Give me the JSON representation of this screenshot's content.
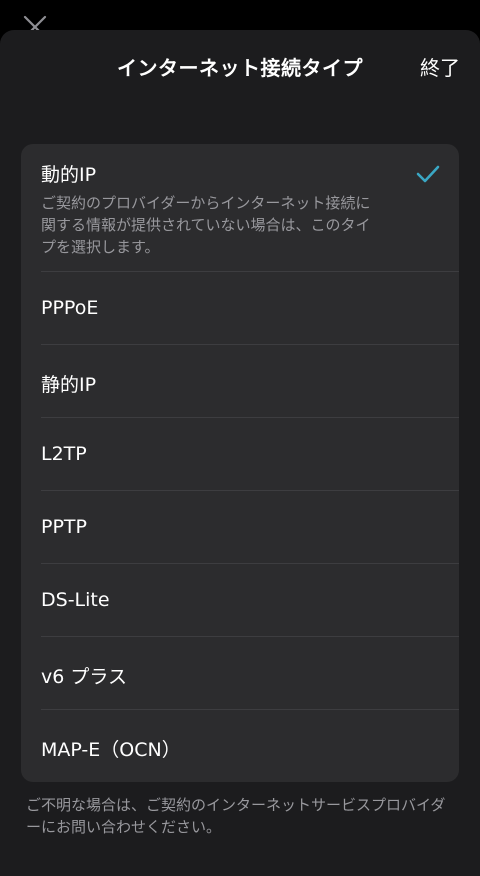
{
  "header": {
    "title": "インターネット接続タイプ",
    "done_label": "終了"
  },
  "options": [
    {
      "label": "動的IP",
      "description": "ご契約のプロバイダーからインターネット接続に関する情報が提供されていない場合は、このタイプを選択します。",
      "selected": true
    },
    {
      "label": "PPPoE",
      "selected": false
    },
    {
      "label": "静的IP",
      "selected": false
    },
    {
      "label": "L2TP",
      "selected": false
    },
    {
      "label": "PPTP",
      "selected": false
    },
    {
      "label": "DS-Lite",
      "selected": false
    },
    {
      "label": "v6 プラス",
      "selected": false
    },
    {
      "label": "MAP-E（OCN）",
      "selected": false
    }
  ],
  "footnote": "ご不明な場合は、ご契約のインターネットサービスプロバイダーにお問い合わせください。",
  "colors": {
    "background": "#000000",
    "sheet": "#1c1c1e",
    "card": "#2c2c2e",
    "primary_text": "#ffffff",
    "secondary_text": "#98989d",
    "accent": "#3aa7c4"
  },
  "icons": {
    "selected_indicator": "checkmark-icon",
    "behind_sheet_button": "close-icon"
  }
}
